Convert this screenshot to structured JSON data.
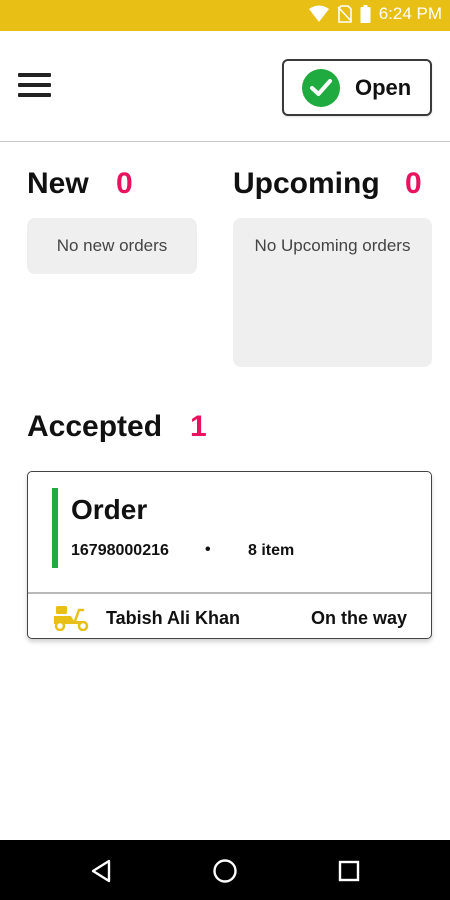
{
  "status_bar": {
    "time": "6:24 PM",
    "icons": [
      "wifi-icon",
      "no-sim-icon",
      "battery-icon"
    ]
  },
  "header": {
    "menu_icon": "hamburger-menu-icon",
    "open_button": {
      "label": "Open",
      "icon": "check-circle-icon",
      "icon_color": "#1fab3f"
    }
  },
  "sections": {
    "new": {
      "title": "New",
      "count": "0",
      "empty_text": "No new orders"
    },
    "upcoming": {
      "title": "Upcoming",
      "count": "0",
      "empty_text": "No Upcoming orders"
    },
    "accepted": {
      "title": "Accepted",
      "count": "1"
    }
  },
  "accepted_orders": [
    {
      "title": "Order",
      "order_number": "16798000216",
      "separator": "•",
      "items": "8  item",
      "rider_icon": "scooter-icon",
      "rider_name": "Tabish Ali Khan",
      "status": "On the way"
    }
  ],
  "nav_bar": {
    "back": "back-icon",
    "home": "home-icon",
    "recents": "recents-icon"
  },
  "colors": {
    "accent": "#e8bf15",
    "count": "#e8135f",
    "success": "#1fab3f"
  }
}
